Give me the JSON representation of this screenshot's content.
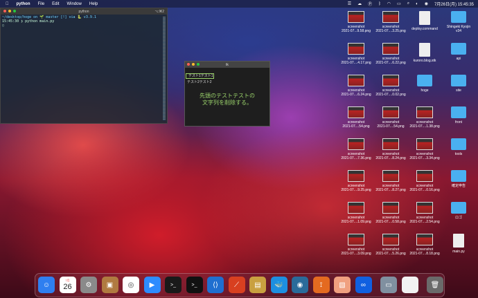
{
  "menubar": {
    "app_name": "python",
    "menus": [
      "File",
      "Edit",
      "Window",
      "Help"
    ],
    "clock": "7月26日(月) 15:45:35",
    "icons": [
      "apple-icon",
      "reminder-icon",
      "cloud-icon",
      "p-icon",
      "bluetooth-icon",
      "wifi-icon",
      "battery-icon",
      "search-icon",
      "control-center-icon",
      "siri-icon"
    ]
  },
  "terminal": {
    "title": "python",
    "size": "⌥⌘2",
    "line1": "~/desktop/hoge on 🌱 master [!] via 🐍 v3.9.1",
    "line2": "15:45:30 ❯ python main.py",
    "cursor": "▯"
  },
  "tk_window": {
    "title": "tk",
    "label1": "テスト1テスト1",
    "label2": "テスト2テスト2",
    "message_line1": "先頭のテストテストの",
    "message_line2": "文字列を削除する。"
  },
  "desktop": {
    "col1": [
      {
        "line1": "screenshot",
        "line2": "2021-07...9.58.png"
      },
      {
        "line1": "screenshot",
        "line2": "2021-07....4.17.png"
      },
      {
        "line1": "screenshot",
        "line2": "2021-07....6.24.png"
      },
      {
        "line1": "screenshot",
        "line2": "2021-07....54.png"
      },
      {
        "line1": "screenshot",
        "line2": "2021-07....7.36.png"
      },
      {
        "line1": "screenshot",
        "line2": "2021-07....9.25.png"
      },
      {
        "line1": "screenshot",
        "line2": "2021-07....1.09.png"
      },
      {
        "line1": "screenshot",
        "line2": "2021-07....3.09.png"
      }
    ],
    "col2": [
      {
        "line1": "screenshot",
        "line2": "2021-07....3.25.png"
      },
      {
        "line1": "screenshot",
        "line2": "2021-07....6.22.png"
      },
      {
        "line1": "screenshot",
        "line2": "2021-07....0.02.png"
      },
      {
        "line1": "screenshot",
        "line2": "2021-07....54.png"
      },
      {
        "line1": "screenshot",
        "line2": "2021-07....8.24.png"
      },
      {
        "line1": "screenshot",
        "line2": "2021-07....8.27.png"
      },
      {
        "line1": "screenshot",
        "line2": "2021-07....0.58.png"
      },
      {
        "line1": "screenshot",
        "line2": "2021-07....5.26.png"
      }
    ],
    "col3": [
      {
        "line1": "deploy.command",
        "line2": "",
        "kind": "doc"
      },
      {
        "line1": "kuroro.blog.stk",
        "line2": "",
        "kind": "doc"
      },
      {
        "line1": "hoge",
        "line2": "",
        "kind": "folder"
      },
      {
        "line1": "screenshot",
        "line2": "2021-07....1.38.png",
        "kind": "shot"
      },
      {
        "line1": "screenshot",
        "line2": "2021-07....3.34.png",
        "kind": "shot"
      },
      {
        "line1": "screenshot",
        "line2": "2021-07....0.16.png",
        "kind": "shot"
      },
      {
        "line1": "screenshot",
        "line2": "2021-07....2.54.png",
        "kind": "shot"
      },
      {
        "line1": "screenshot",
        "line2": "2021-07....8.18.png",
        "kind": "shot"
      }
    ],
    "col4": [
      {
        "line1": "Shingeki Kyojin",
        "line2": "v34",
        "kind": "folder"
      },
      {
        "line1": "api",
        "line2": "",
        "kind": "folder"
      },
      {
        "line1": "site",
        "line2": "",
        "kind": "folder"
      },
      {
        "line1": "front",
        "line2": "",
        "kind": "folder"
      },
      {
        "line1": "tools",
        "line2": "",
        "kind": "folder"
      },
      {
        "line1": "確定申告",
        "line2": "",
        "kind": "folder"
      },
      {
        "line1": "ロゴ",
        "line2": "",
        "kind": "folder"
      },
      {
        "line1": "main.py",
        "line2": "",
        "kind": "doc"
      }
    ]
  },
  "dock": {
    "calendar_month": "7月",
    "calendar_day": "26",
    "apps": [
      "finder-icon",
      "calendar-icon",
      "system-preferences-icon",
      "contacts-icon",
      "chrome-icon",
      "zoom-icon",
      "iterm-icon",
      "terminal-icon",
      "vscode-icon",
      "activity-icon",
      "lineup-icon",
      "docker-icon",
      "proxyman-icon",
      "sourcetree-icon",
      "preview-icon",
      "infinity-icon",
      "screenshot-icon",
      "document-icon",
      "trash-icon"
    ],
    "colors": [
      "#2f7ff0",
      "#ffffff",
      "#8a8a8a",
      "#b07a40",
      "#ffffff",
      "#2d8cff",
      "#1a1a1a",
      "#111111",
      "#1f6fd0",
      "#d84020",
      "#c9a040",
      "#1d8fe0",
      "#2a6b9a",
      "#e46a20",
      "#f0a080",
      "#1060e0",
      "#8090a0",
      "#f2f2f2",
      "#6a6a6a"
    ]
  }
}
